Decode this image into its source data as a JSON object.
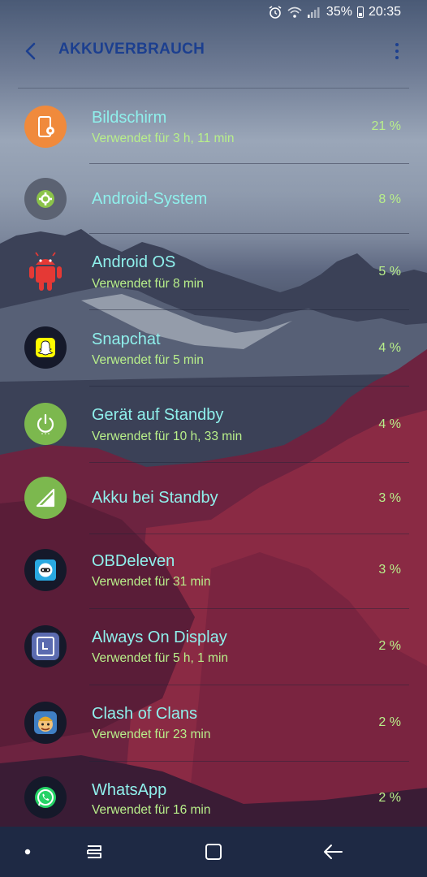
{
  "status": {
    "battery_percent": "35%",
    "time": "20:35"
  },
  "appbar": {
    "title": "AKKUVERBRAUCH"
  },
  "items": [
    {
      "name": "Bildschirm",
      "usage": "Verwendet für 3 h, 11 min",
      "percent": "21 %",
      "icon": "screen-settings-icon"
    },
    {
      "name": "Android-System",
      "usage": "",
      "percent": "8 %",
      "icon": "android-system-gear-icon"
    },
    {
      "name": "Android OS",
      "usage": "Verwendet für 8 min",
      "percent": "5 %",
      "icon": "android-robot-icon"
    },
    {
      "name": "Snapchat",
      "usage": "Verwendet für 5 min",
      "percent": "4 %",
      "icon": "snapchat-ghost-icon"
    },
    {
      "name": "Gerät auf Standby",
      "usage": "Verwendet für 10 h, 33 min",
      "percent": "4 %",
      "icon": "power-standby-icon"
    },
    {
      "name": "Akku bei Standby",
      "usage": "",
      "percent": "3 %",
      "icon": "signal-standby-icon"
    },
    {
      "name": "OBDeleven",
      "usage": "Verwendet für 31 min",
      "percent": "3 %",
      "icon": "obdeleven-icon"
    },
    {
      "name": "Always On Display",
      "usage": "Verwendet für 5 h, 1 min",
      "percent": "2 %",
      "icon": "always-on-display-icon"
    },
    {
      "name": "Clash of Clans",
      "usage": "Verwendet für 23 min",
      "percent": "2 %",
      "icon": "clash-of-clans-icon"
    },
    {
      "name": "WhatsApp",
      "usage": "Verwendet für 16 min",
      "percent": "2 %",
      "icon": "whatsapp-icon"
    }
  ],
  "colors": {
    "title": "#1c3f8f",
    "item_label": "#8ff0ec",
    "item_sub": "#b8ef8a",
    "navbar": "#1e2944"
  }
}
